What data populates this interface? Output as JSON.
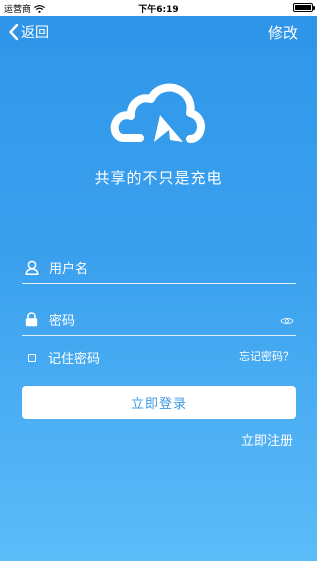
{
  "status_bar": {
    "carrier": "运营商",
    "time": "下午6:19",
    "wifi_icon": "wifi-icon",
    "battery_icon": "battery-icon"
  },
  "nav": {
    "back_label": "返回",
    "back_icon": "chevron-left-icon",
    "edit_label": "修改"
  },
  "brand": {
    "logo_icon": "cloud-charging-logo",
    "slogan": "共享的不只是充电"
  },
  "form": {
    "username_placeholder": "用户名",
    "username_value": "",
    "password_placeholder": "密码",
    "password_value": "",
    "remember_label": "记住密码",
    "remember_checked": false,
    "forgot_label": "忘记密码？",
    "login_label": "立即登录",
    "register_label": "立即注册"
  },
  "colors": {
    "primary": "#2f95e8",
    "gradient_bottom": "#5cbcf8",
    "button_text": "#3a9ae8",
    "white": "#ffffff"
  }
}
